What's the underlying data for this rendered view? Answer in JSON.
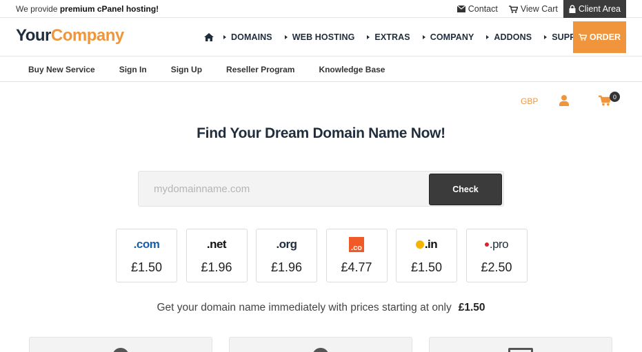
{
  "topbar": {
    "tagline_prefix": "We provide ",
    "tagline_bold": "premium cPanel hosting!",
    "contact": "Contact",
    "view_cart": "View Cart",
    "client_area": "Client Area"
  },
  "header": {
    "logo_part1": "Your",
    "logo_part2": "Company",
    "nav": [
      "DOMAINS",
      "WEB HOSTING",
      "EXTRAS",
      "COMPANY",
      "ADDONS",
      "SUPPORT"
    ],
    "order": "ORDER"
  },
  "subnav": [
    "Buy New Service",
    "Sign In",
    "Sign Up",
    "Reseller Program",
    "Knowledge Base"
  ],
  "utility": {
    "currency": "GBP",
    "cart_count": "0"
  },
  "hero": {
    "title": "Find Your Dream Domain Name Now!",
    "search_placeholder": "mydomainname.com",
    "check": "Check"
  },
  "tlds": [
    {
      "name": ".com",
      "price": "£1.50"
    },
    {
      "name": ".net",
      "price": "£1.96"
    },
    {
      "name": ".org",
      "price": "£1.96"
    },
    {
      "name": ".co",
      "price": "£4.77"
    },
    {
      "name": ".in",
      "price": "£1.50"
    },
    {
      "name": ".pro",
      "price": "£2.50"
    }
  ],
  "starting": {
    "text": "Get your domain name immediately with prices starting at only",
    "price": "£1.50"
  },
  "colors": {
    "accent": "#f0953b",
    "dark": "#3b3b3b",
    "navy": "#1f2d3d"
  }
}
